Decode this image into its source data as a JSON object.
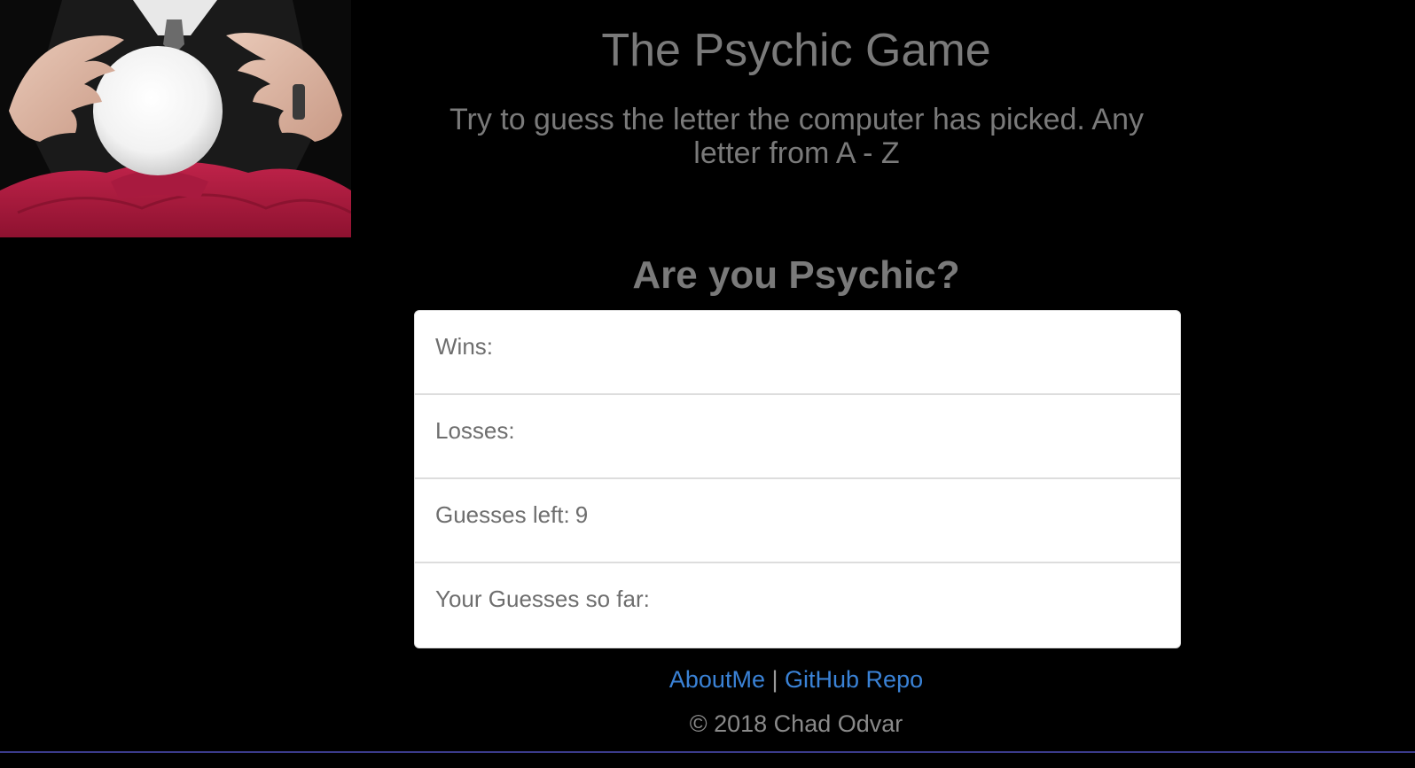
{
  "header": {
    "title": "The Psychic Game",
    "subtitle": "Try to guess the letter the computer has picked. Any letter from A - Z"
  },
  "hero_image": {
    "description_icon": "crystal-ball-image"
  },
  "game": {
    "question": "Are you Psychic?",
    "stats": [
      {
        "label": "Wins:",
        "value": ""
      },
      {
        "label": "Losses:",
        "value": ""
      },
      {
        "label": "Guesses left:",
        "value": "9"
      },
      {
        "label": "Your Guesses so far:",
        "value": ""
      }
    ]
  },
  "footer": {
    "about_link": "AboutMe",
    "separator": "|",
    "github_link": "GitHub Repo",
    "copyright": "© 2018 Chad Odvar"
  },
  "colors": {
    "background": "#000000",
    "text_gray": "#7a7a7a",
    "link_blue": "#3a82d6",
    "cloth_red": "#b3173f"
  }
}
